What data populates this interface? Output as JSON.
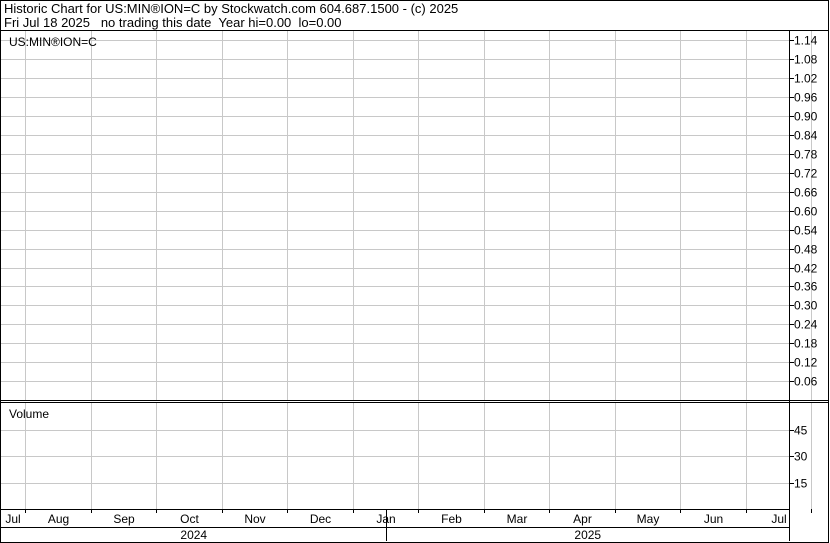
{
  "header": {
    "line1": "Historic Chart for US:MIN®ION=C by Stockwatch.com 604.687.1500 - (c) 2025",
    "line2": "Fri Jul 18 2025   no trading this date  Year hi=0.00  lo=0.00"
  },
  "chart_data": {
    "type": "line",
    "symbol_label": "US:MIN®ION=C",
    "volume_label": "Volume",
    "price_axis": {
      "ylim": [
        0.0,
        1.17
      ],
      "ticks": [
        "1.14",
        "1.08",
        "1.02",
        "0.96",
        "0.90",
        "0.84",
        "0.78",
        "0.72",
        "0.66",
        "0.60",
        "0.54",
        "0.48",
        "0.42",
        "0.36",
        "0.30",
        "0.24",
        "0.18",
        "0.12",
        "0.06"
      ]
    },
    "volume_axis": {
      "ylim": [
        0,
        60
      ],
      "ticks": [
        "45",
        "30",
        "15"
      ]
    },
    "months": [
      "Jul",
      "Aug",
      "Sep",
      "Oct",
      "Nov",
      "Dec",
      "Jan",
      "Feb",
      "Mar",
      "Apr",
      "May",
      "Jun",
      "Jul"
    ],
    "years": [
      "2024",
      "2025"
    ],
    "series": [],
    "grid": true,
    "colors": {
      "grid": "#c8c8c8",
      "frame": "#000000",
      "background": "#ffffff"
    }
  }
}
